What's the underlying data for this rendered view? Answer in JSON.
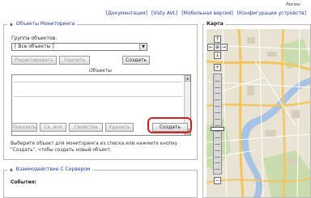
{
  "header": {
    "login": "Логин:",
    "links": [
      "[Документация]",
      "[Visty AVL]",
      "[Мобильная версия]",
      "[Конфигурация устройств]"
    ]
  },
  "objects_panel": {
    "title": "Объекты Мониторинга",
    "group_label": "Группа объектов:",
    "group_select_value": "[ Все объекты ]",
    "top_buttons": {
      "edit": "Редактировать",
      "delete": "Удалить",
      "create": "Создать"
    },
    "list_label": "Объекты",
    "bottom_buttons": {
      "show": "Показать",
      "show_all": "Ск. все",
      "properties": "Свойства",
      "delete": "Удалить",
      "create": "Создать"
    },
    "hint": "Выберите объект для мониторинга из списка или нажмите кнопку \"Создать\", чтобы создать новый объект."
  },
  "server_panel": {
    "title": "Взаимодействие С Сервером",
    "events_label": "События:"
  },
  "map_panel": {
    "title": "Карта",
    "controls": {
      "up": "↑",
      "left": "←",
      "center": "⊕",
      "right": "→",
      "down": "↓",
      "zoom_in": "+",
      "zoom_out": "−"
    },
    "zoom_level_fraction": 0.45
  },
  "colors": {
    "link": "#1f3c9c",
    "highlight": "#d02020",
    "map_road": "#f5c96a",
    "map_bg": "#e8e2d2"
  }
}
